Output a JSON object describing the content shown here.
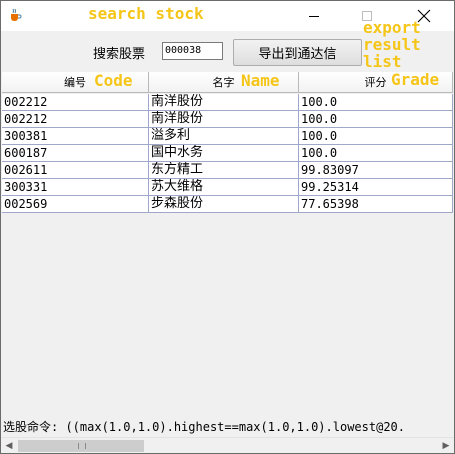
{
  "window": {
    "icon": "java-cup-icon"
  },
  "toolbar": {
    "search_label": "搜索股票",
    "search_value": "000038",
    "export_label": "导出到通达信"
  },
  "table": {
    "headers": [
      "编号",
      "名字",
      "评分"
    ],
    "rows": [
      [
        "002212",
        "南洋股份",
        "100.0"
      ],
      [
        "002212",
        "南洋股份",
        "100.0"
      ],
      [
        "300381",
        "溢多利",
        "100.0"
      ],
      [
        "600187",
        "国中水务",
        "100.0"
      ],
      [
        "002611",
        "东方精工",
        "99.83097"
      ],
      [
        "300331",
        "苏大维格",
        "99.25314"
      ],
      [
        "002569",
        "步森股份",
        "77.65398"
      ]
    ]
  },
  "command_line": "选股命令: ((max(1.0,1.0).highest==max(1.0,1.0).lowest@20.",
  "annotations": {
    "search": "search stock",
    "export": "export\nresult\nlist",
    "code": "Code",
    "name": "Name",
    "grade": "Grade"
  },
  "colors": {
    "annotation": "#f5c518",
    "grid": "#9fa8c8"
  }
}
